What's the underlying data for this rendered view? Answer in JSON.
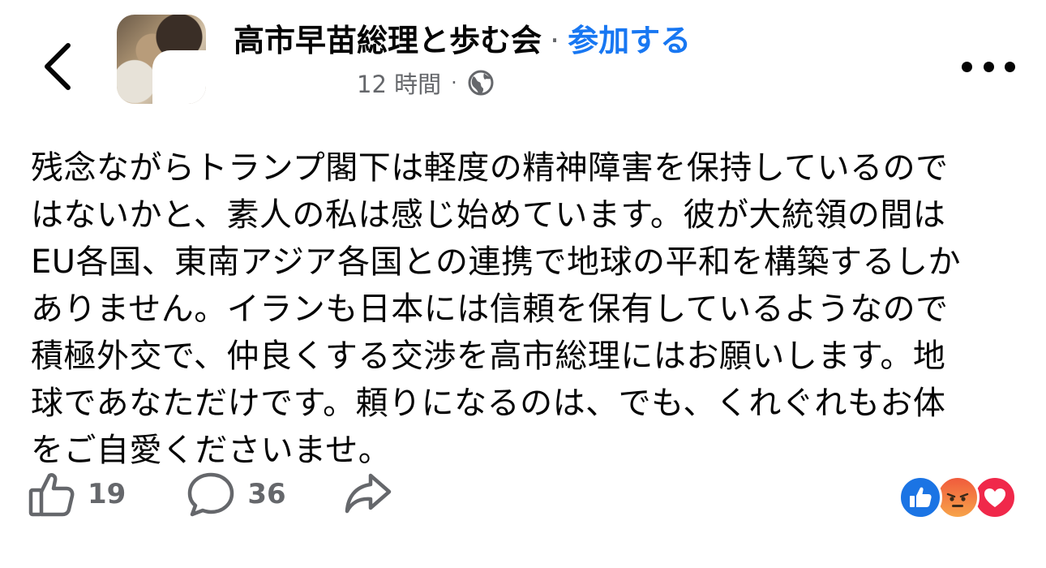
{
  "header": {
    "group_name": "高市早苗総理と歩む会",
    "separator": "·",
    "join_label": "参加する",
    "time_label": "12 時間",
    "meta_dot": "·",
    "privacy_icon": "globe-icon",
    "back_icon": "chevron-left-icon",
    "more_icon": "more-horizontal-icon"
  },
  "post": {
    "lines": [
      "残念ながらトランプ閣下は軽度の精神障害を保持しているので",
      "はないかと、素人の私は感じ始めています。彼が大統領の間は",
      "EU各国、東南アジア各国との連携で地球の平和を構築するしか",
      "ありません。イランも日本には信頼を保有しているようなので",
      "積極外交で、仲良くする交渉を高市総理にはお願いします。地",
      "球であなただけです。頼りになるのは、でも、くれぐれもお体",
      "をご自愛くださいませ。"
    ]
  },
  "actions": {
    "like_count": "19",
    "comment_count": "36",
    "like_icon": "thumbs-up-icon",
    "comment_icon": "comment-bubble-icon",
    "share_icon": "share-arrow-icon"
  },
  "reactions": [
    "like-reaction-icon",
    "angry-reaction-icon",
    "love-reaction-icon"
  ],
  "colors": {
    "accent": "#1877f2",
    "meta_gray": "#65676b",
    "text": "#050505",
    "like_blue": "#1b74e4",
    "love_red": "#f0284a",
    "angry_orange": "#f05b3c"
  }
}
